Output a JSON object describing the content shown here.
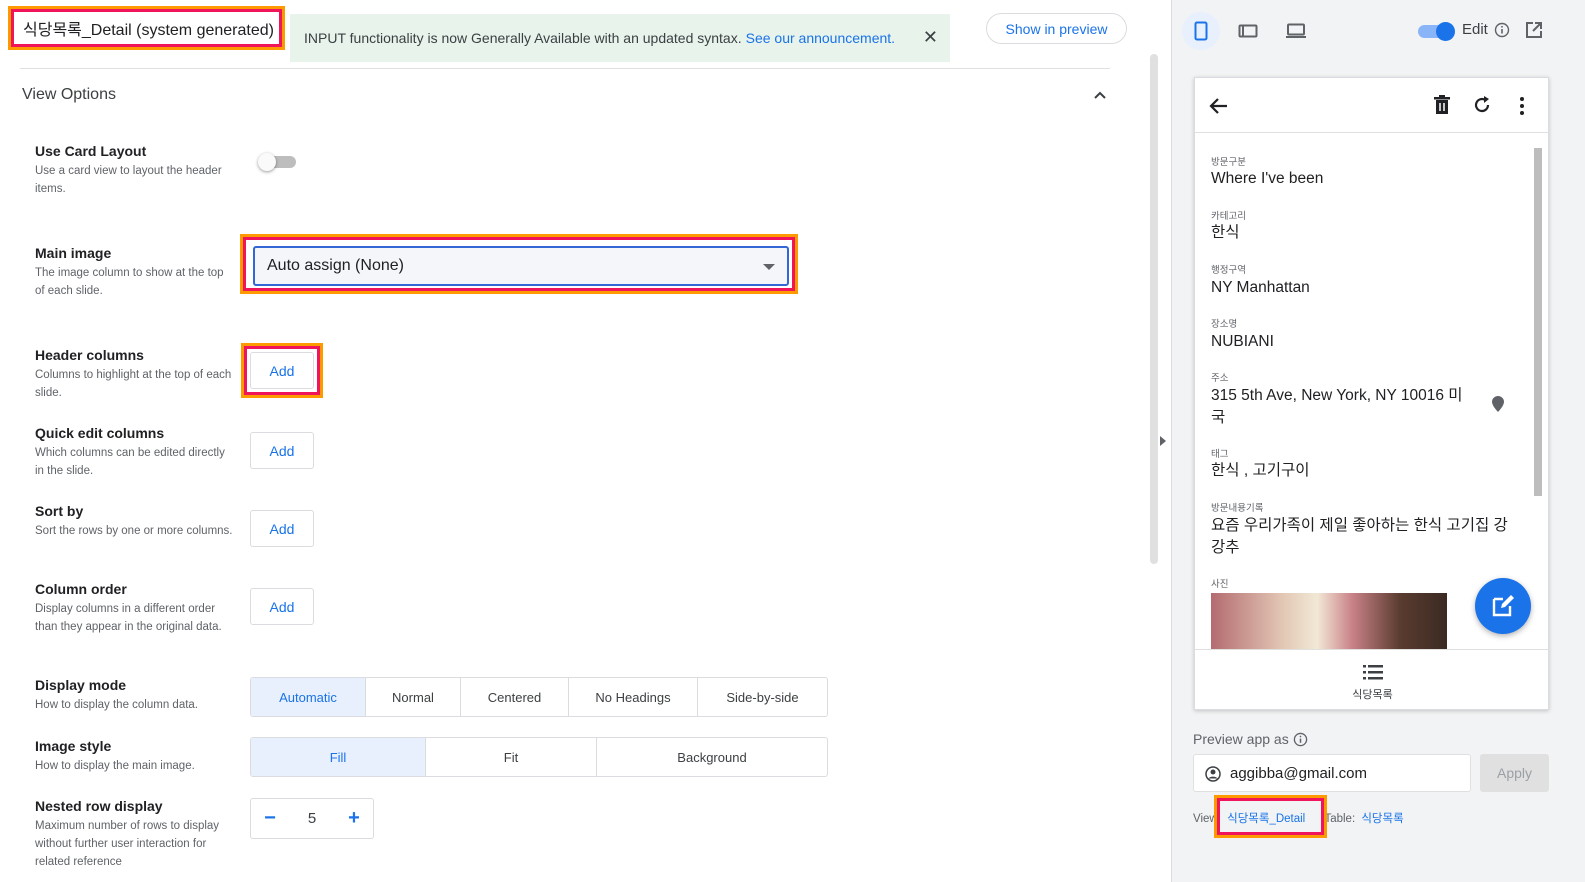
{
  "editor": {
    "view_title": "식당목록_Detail (system generated)",
    "banner": {
      "text": "INPUT functionality is now Generally Available with an updated syntax.",
      "link": "See our announcement.",
      "close": "✕"
    },
    "show_in_preview": "Show in preview",
    "section_title": "View Options",
    "use_card_layout": {
      "label": "Use Card Layout",
      "desc": "Use a card view to layout the header items.",
      "enabled": false
    },
    "main_image": {
      "label": "Main image",
      "desc": "The image column to show at the top of each slide.",
      "value": "Auto assign (None)"
    },
    "header_columns": {
      "label": "Header columns",
      "desc": "Columns to highlight at the top of each slide.",
      "button": "Add"
    },
    "quick_edit_columns": {
      "label": "Quick edit columns",
      "desc": "Which columns can be edited directly in the slide.",
      "button": "Add"
    },
    "sort_by": {
      "label": "Sort by",
      "desc": "Sort the rows by one or more columns.",
      "button": "Add"
    },
    "column_order": {
      "label": "Column order",
      "desc": "Display columns in a different order than they appear in the original data.",
      "button": "Add"
    },
    "display_mode": {
      "label": "Display mode",
      "desc": "How to display the column data.",
      "options": [
        "Automatic",
        "Normal",
        "Centered",
        "No Headings",
        "Side-by-side"
      ],
      "selected": "Automatic"
    },
    "image_style": {
      "label": "Image style",
      "desc": "How to display the main image.",
      "options": [
        "Fill",
        "Fit",
        "Background"
      ],
      "selected": "Fill"
    },
    "nested_row_display": {
      "label": "Nested row display",
      "desc": "Maximum number of rows to display without further user interaction for related reference",
      "value": "5",
      "minus": "−",
      "plus": "+"
    }
  },
  "preview": {
    "edit_label": "Edit",
    "fields": [
      {
        "label": "방문구분",
        "value": "Where I've been"
      },
      {
        "label": "카테고리",
        "value": "한식"
      },
      {
        "label": "행정구역",
        "value": "NY Manhattan"
      },
      {
        "label": "장소명",
        "value": "NUBIANI"
      },
      {
        "label": "주소",
        "value": "315 5th Ave, New York, NY 10016 미국"
      },
      {
        "label": "태그",
        "value": "한식 , 고기구이"
      },
      {
        "label": "방문내용기록",
        "value": "요즘 우리가족이 제일 좋아하는 한식 고기집 강강추"
      },
      {
        "label": "사진",
        "value": ""
      }
    ],
    "nav_label": "식당목록",
    "preview_as_label": "Preview app as",
    "email": "aggibba@gmail.com",
    "apply": "Apply",
    "view_prefix": "View:",
    "view_name": "식당목록_Detail",
    "table_prefix": "Table:",
    "table_name": "식당목록"
  },
  "colors": {
    "accent": "#1a73e8",
    "highlight_outer": "#ff9900",
    "highlight_inner": "#f0145a"
  }
}
